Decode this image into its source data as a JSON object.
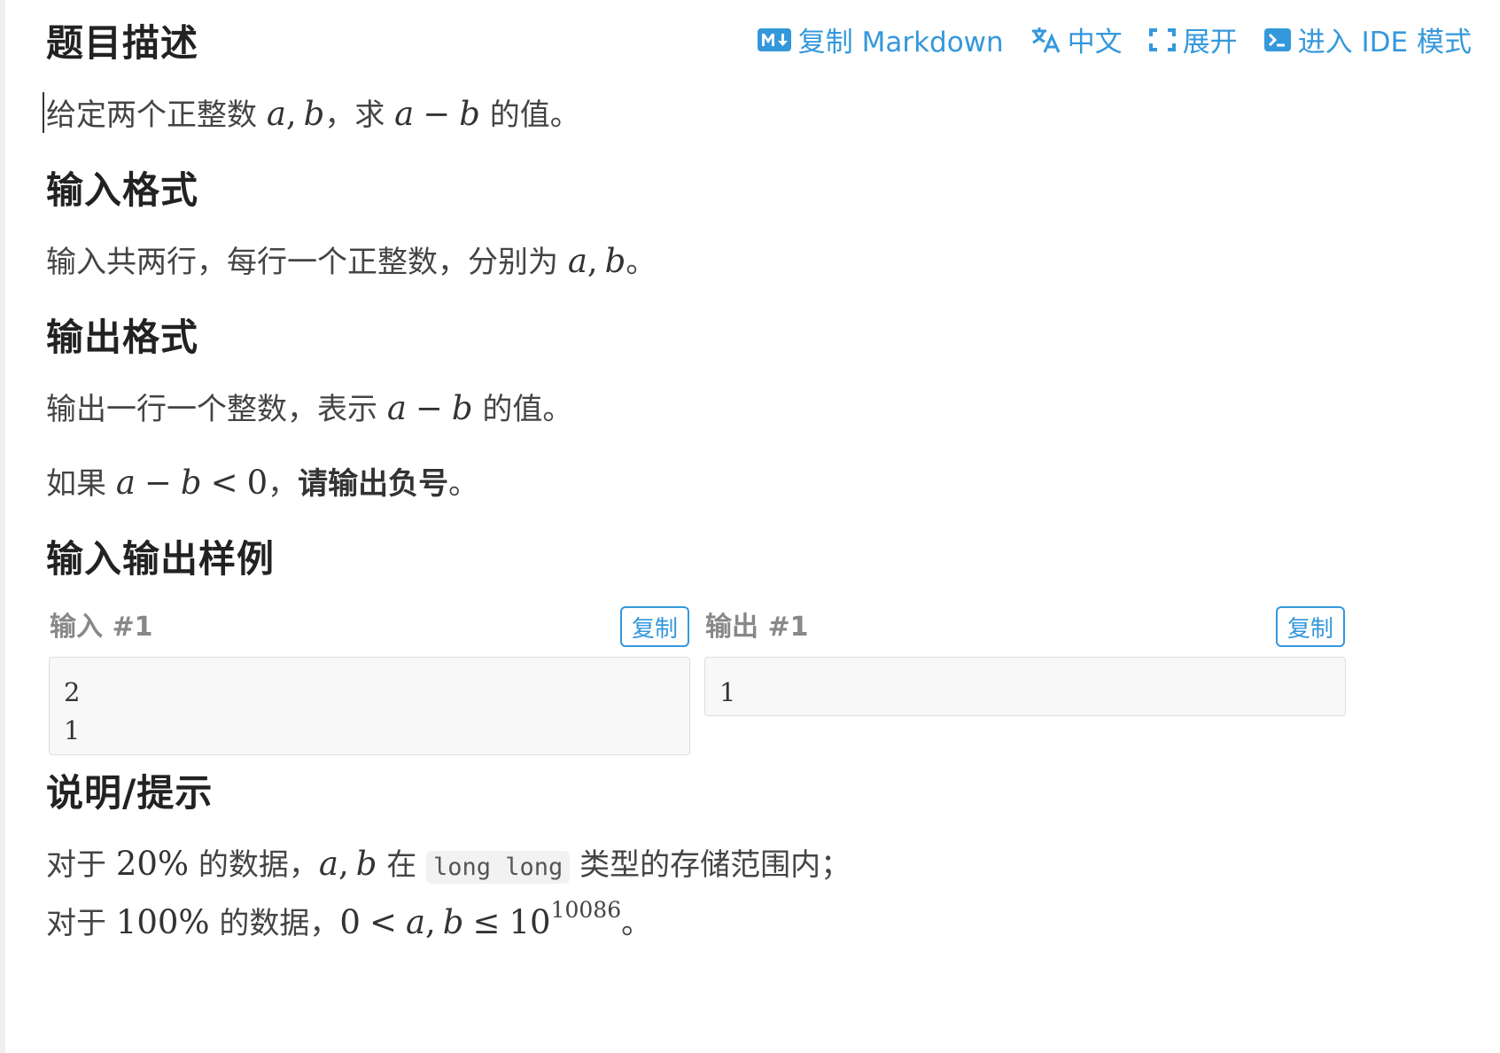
{
  "headings": {
    "description": "题目描述",
    "input_format": "输入格式",
    "output_format": "输出格式",
    "samples": "输入输出样例",
    "hint": "说明/提示"
  },
  "toolbar": {
    "copy_markdown": "复制 Markdown",
    "language": "中文",
    "expand": "展开",
    "ide_mode": "进入 IDE 模式"
  },
  "description": {
    "prefix": "给定两个正整数",
    "var_a": "a",
    "comma": ",",
    "var_b": "b",
    "mid": "，求",
    "minus": "−",
    "suffix": "的值。"
  },
  "input_format": {
    "prefix": "输入共两行，每行一个正整数，分别为",
    "var_a": "a",
    "comma": ",",
    "var_b": "b",
    "suffix": "。"
  },
  "output_format": {
    "line1_prefix": "输出一行一个整数，表示",
    "var_a": "a",
    "minus": "−",
    "var_b": "b",
    "line1_suffix": "的值。",
    "line2_prefix": "如果",
    "lt": "<",
    "zero": "0",
    "line2_mid": "，",
    "line2_bold": "请输出负号",
    "line2_suffix": "。"
  },
  "samples": {
    "input_label": "输入 #1",
    "output_label": "输出 #1",
    "copy_label": "复制",
    "input_value": "2\n1",
    "output_value": "1"
  },
  "hint": {
    "l1_prefix": "对于",
    "l1_percent": "20%",
    "l1_mid": "的数据，",
    "var_a": "a",
    "comma": ",",
    "var_b": "b",
    "l1_in": "在",
    "l1_code": "long long",
    "l1_suffix": "类型的存储范围内；",
    "l2_prefix": "对于",
    "l2_percent": "100%",
    "l2_mid": "的数据，",
    "zero": "0",
    "lt": "<",
    "le": "≤",
    "base": "10",
    "exponent": "10086",
    "l2_suffix": "。"
  },
  "colors": {
    "accent": "#3498db",
    "heading": "#222222",
    "text": "#444444",
    "sample_bg": "#f8f8f8"
  }
}
